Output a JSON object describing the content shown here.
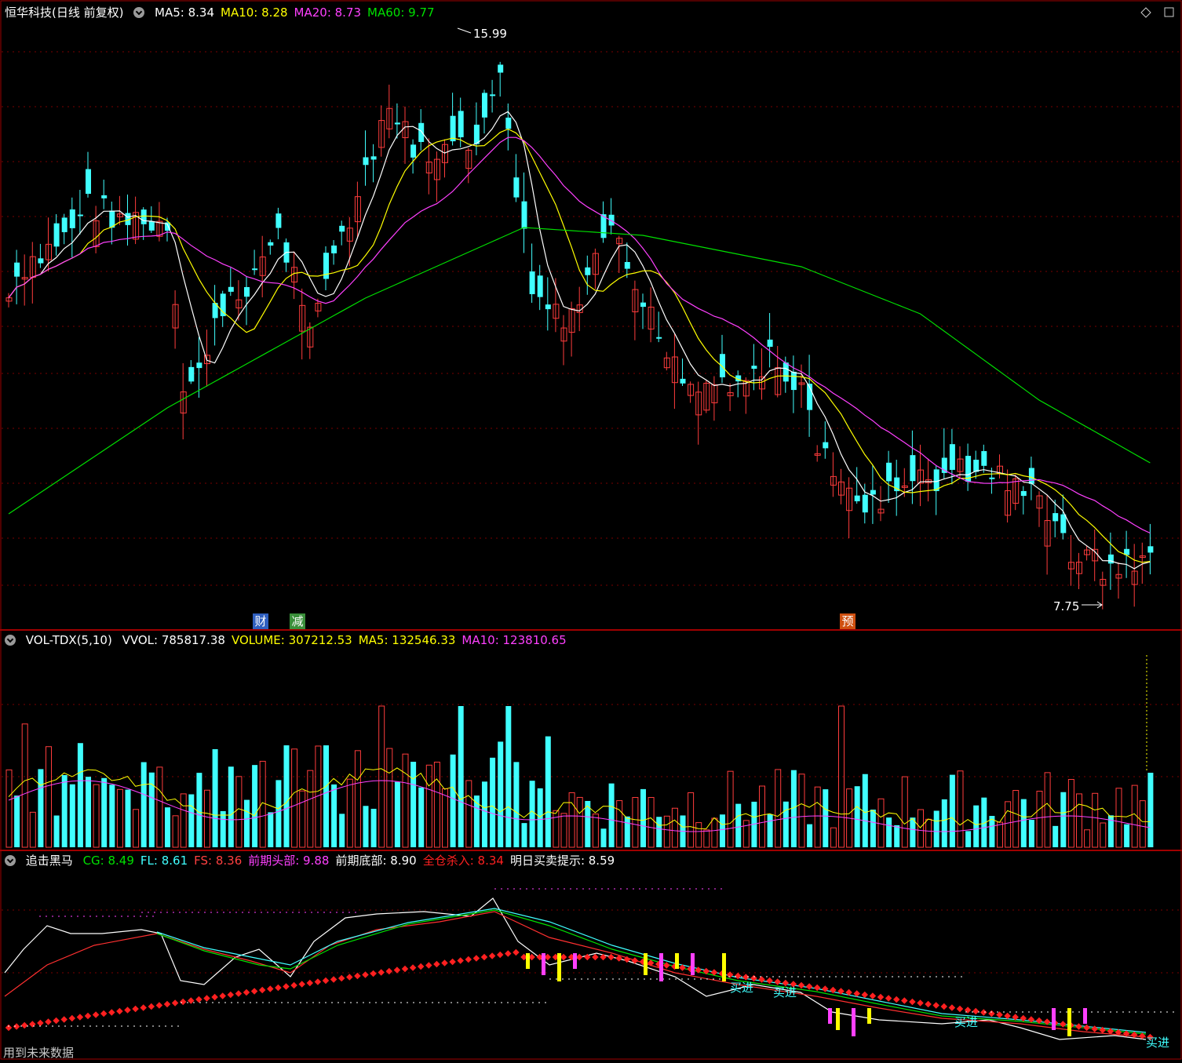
{
  "main_panel": {
    "title": "恒华科技(日线 前复权)",
    "indicators": [
      {
        "label": "MA5:",
        "value": "8.34",
        "color": "#ffffff"
      },
      {
        "label": "MA10:",
        "value": "8.28",
        "color": "#ffff00"
      },
      {
        "label": "MA20:",
        "value": "8.73",
        "color": "#ff40ff"
      },
      {
        "label": "MA60:",
        "value": "9.77",
        "color": "#00e000"
      }
    ],
    "high_marker": "15.99",
    "low_marker": "7.75",
    "badges": [
      {
        "text": "财",
        "bg": "#2f5fbf",
        "color": "#ffffff"
      },
      {
        "text": "减",
        "bg": "#3a8f3a",
        "color": "#ffffff"
      },
      {
        "text": "预",
        "bg": "#d05010",
        "color": "#ffffff"
      }
    ]
  },
  "volume_panel": {
    "name": "VOL-TDX(5,10)",
    "indicators": [
      {
        "label": "VVOL:",
        "value": "785817.38",
        "color": "#ffffff"
      },
      {
        "label": "VOLUME:",
        "value": "307212.53",
        "color": "#ffff00"
      },
      {
        "label": "MA5:",
        "value": "132546.33",
        "color": "#ffff00"
      },
      {
        "label": "MA10:",
        "value": "123810.65",
        "color": "#ff40ff"
      }
    ]
  },
  "signal_panel": {
    "name": "追击黑马",
    "indicators": [
      {
        "label": "CG:",
        "value": "8.49",
        "color": "#00e000"
      },
      {
        "label": "FL:",
        "value": "8.61",
        "color": "#40ffff"
      },
      {
        "label": "FS:",
        "value": "8.36",
        "color": "#ff4040"
      },
      {
        "label": "前期头部:",
        "value": "9.88",
        "color": "#ff40ff"
      },
      {
        "label": "前期底部:",
        "value": "8.90",
        "color": "#ffffff"
      },
      {
        "label": "全仓杀入:",
        "value": "8.34",
        "color": "#ff2020"
      },
      {
        "label": "明日买卖提示:",
        "value": "8.59",
        "color": "#ffffff"
      }
    ],
    "buy_label": "买进"
  },
  "footnote": "用到未来数据",
  "colors": {
    "up": "#ff3c3c",
    "down": "#40ffff",
    "grid": "#7a0000",
    "border": "#a00000"
  },
  "chart_data": {
    "type": "candlestick",
    "price_axis": {
      "ylim": [
        7.3,
        16.4
      ]
    },
    "candles_sample": {
      "note_excluded": true
    }
  }
}
